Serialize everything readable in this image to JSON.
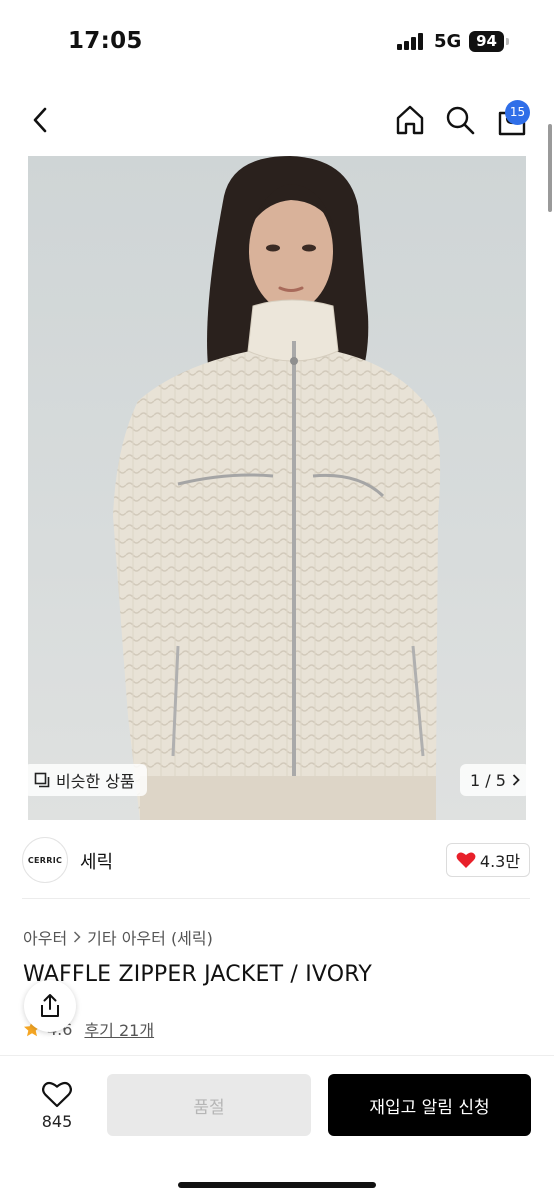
{
  "status_bar": {
    "time": "17:05",
    "network": "5G",
    "battery": "94"
  },
  "nav": {
    "cart_count": "15"
  },
  "gallery": {
    "similar_label": "비슷한 상품",
    "page_indicator": "1 / 5"
  },
  "brand": {
    "logo_text": "CERRIC",
    "name": "세릭",
    "likes": "4.3만"
  },
  "breadcrumb": {
    "category": "아우터",
    "subcategory": "기타 아우터 (세릭)"
  },
  "product": {
    "title": "WAFFLE ZIPPER JACKET / IVORY",
    "rating": "4.6",
    "reviews_label": "후기 21개"
  },
  "bottom_bar": {
    "wish_count": "845",
    "soldout_label": "품절",
    "restock_label": "재입고 알림 신청"
  },
  "colors": {
    "accent_blue": "#2f6ee8",
    "heart_red": "#e8202a",
    "star_orange": "#f5a623",
    "cta_black": "#000000"
  }
}
